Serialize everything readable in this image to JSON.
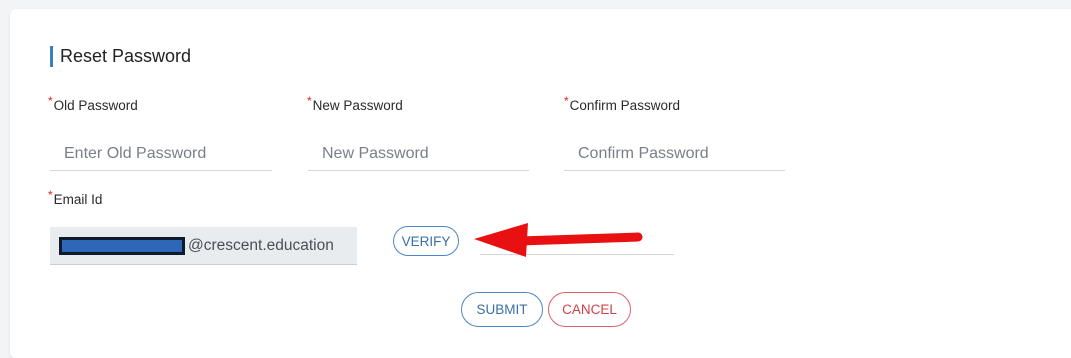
{
  "page": {
    "title": "Reset Password"
  },
  "fields": {
    "old_password": {
      "label": "Old Password",
      "placeholder": "Enter Old Password"
    },
    "new_password": {
      "label": "New Password",
      "placeholder": "New Password"
    },
    "confirm_password": {
      "label": "Confirm Password",
      "placeholder": "Confirm Password"
    },
    "email": {
      "label": "Email Id",
      "domain": "@crescent.education"
    }
  },
  "required_marker": "*",
  "buttons": {
    "verify": "VERIFY",
    "submit": "SUBMIT",
    "cancel": "CANCEL"
  },
  "colors": {
    "accent": "#3a7fc4",
    "required": "#e02020",
    "annotation_arrow": "#e81010"
  },
  "icons": {
    "annotation": "red-arrow-pointing-left"
  }
}
